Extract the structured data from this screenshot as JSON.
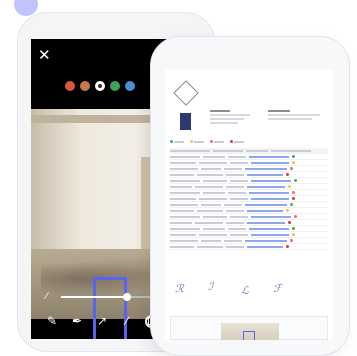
{
  "editor": {
    "colors": [
      "#d55a3a",
      "#c47a4e",
      "#ffffff",
      "#3fa25a",
      "#4a8fd8"
    ],
    "selected_color_index": 2,
    "accent": "#5a63ee",
    "stroke_width": 0.6,
    "icons": [
      "close-icon",
      "pen-icon",
      "highlighter-icon",
      "arrow-icon",
      "line-icon",
      "shape-icon"
    ]
  },
  "report": {
    "accent": "#8fa7ea",
    "status_colors": [
      "#4caf50",
      "#f2c94c",
      "#e57373",
      "#e53935"
    ],
    "icons": [
      "logo-icon",
      "signature-icon"
    ]
  }
}
